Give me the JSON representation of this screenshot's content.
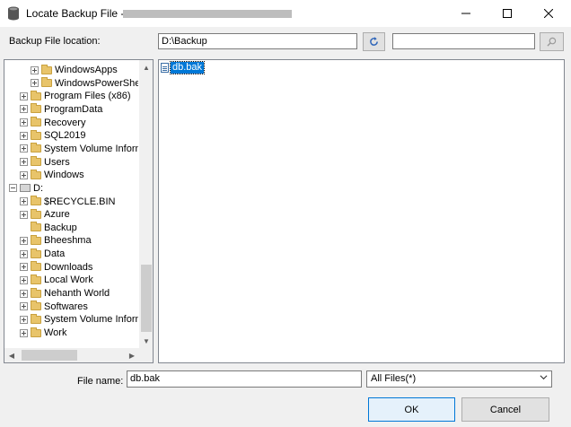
{
  "window": {
    "title": "Locate Backup File -"
  },
  "location": {
    "label": "Backup File location:",
    "value": "D:\\Backup",
    "search_value": ""
  },
  "tree": {
    "items": [
      {
        "label": "WindowsApps",
        "level": 2,
        "expander": "plus",
        "icon": "folder"
      },
      {
        "label": "WindowsPowerShel",
        "level": 2,
        "expander": "plus",
        "icon": "folder"
      },
      {
        "label": "Program Files (x86)",
        "level": 1,
        "expander": "plus",
        "icon": "folder"
      },
      {
        "label": "ProgramData",
        "level": 1,
        "expander": "plus",
        "icon": "folder"
      },
      {
        "label": "Recovery",
        "level": 1,
        "expander": "plus",
        "icon": "folder"
      },
      {
        "label": "SQL2019",
        "level": 1,
        "expander": "plus",
        "icon": "folder"
      },
      {
        "label": "System Volume Inform",
        "level": 1,
        "expander": "plus",
        "icon": "folder"
      },
      {
        "label": "Users",
        "level": 1,
        "expander": "plus",
        "icon": "folder"
      },
      {
        "label": "Windows",
        "level": 1,
        "expander": "plus",
        "icon": "folder"
      },
      {
        "label": "D:",
        "level": 0,
        "expander": "minus",
        "icon": "drive"
      },
      {
        "label": "$RECYCLE.BIN",
        "level": 1,
        "expander": "plus",
        "icon": "folder"
      },
      {
        "label": "Azure",
        "level": 1,
        "expander": "plus",
        "icon": "folder"
      },
      {
        "label": "Backup",
        "level": 1,
        "expander": "none",
        "icon": "folder"
      },
      {
        "label": "Bheeshma",
        "level": 1,
        "expander": "plus",
        "icon": "folder"
      },
      {
        "label": "Data",
        "level": 1,
        "expander": "plus",
        "icon": "folder"
      },
      {
        "label": "Downloads",
        "level": 1,
        "expander": "plus",
        "icon": "folder"
      },
      {
        "label": "Local Work",
        "level": 1,
        "expander": "plus",
        "icon": "folder"
      },
      {
        "label": "Nehanth World",
        "level": 1,
        "expander": "plus",
        "icon": "folder"
      },
      {
        "label": "Softwares",
        "level": 1,
        "expander": "plus",
        "icon": "folder"
      },
      {
        "label": "System Volume Inform",
        "level": 1,
        "expander": "plus",
        "icon": "folder"
      },
      {
        "label": "Work",
        "level": 1,
        "expander": "plus",
        "icon": "folder"
      }
    ]
  },
  "files": [
    {
      "name": "db.bak",
      "selected": true,
      "icon": "file-icon"
    }
  ],
  "footer": {
    "file_name_label": "File name:",
    "file_name_value": "db.bak",
    "filter_value": "All Files(*)",
    "ok_label": "OK",
    "cancel_label": "Cancel"
  },
  "colors": {
    "selection": "#0078d7",
    "folder": "#e8c46a"
  }
}
